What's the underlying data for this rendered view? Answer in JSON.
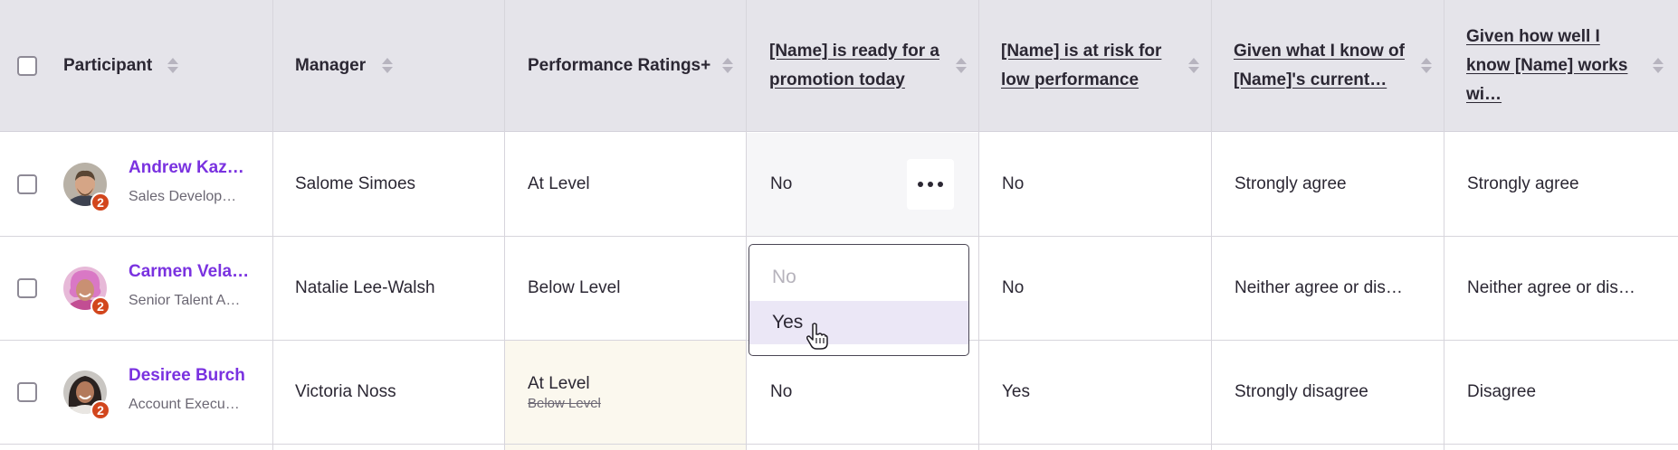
{
  "header": {
    "participant": "Participant",
    "manager": "Manager",
    "performance": "Performance Ratings+",
    "q1_line1": "[Name] is ready for a",
    "q1_line2": "promotion today",
    "q2_line1": "[Name] is at risk for",
    "q2_line2": "low performance",
    "q3_line1": "Given what I know of",
    "q3_line2": "[Name]'s current…",
    "q4_line1": "Given how well I",
    "q4_line2": "know [Name] works",
    "q4_line3": "wi…"
  },
  "rows": [
    {
      "name": "Andrew Kaz…",
      "title": "Sales Develop…",
      "badge": "2",
      "manager": "Salome Simoes",
      "rating": "At Level",
      "rating_previous": "",
      "q1": "No",
      "q2": "No",
      "q3": "Strongly agree",
      "q4": "Strongly agree"
    },
    {
      "name": "Carmen Vela…",
      "title": "Senior Talent A…",
      "badge": "2",
      "manager": "Natalie Lee-Walsh",
      "rating": "Below Level",
      "rating_previous": "",
      "q1": "",
      "q2": "No",
      "q3": "Neither agree or dis…",
      "q4": "Neither agree or dis…"
    },
    {
      "name": "Desiree Burch",
      "title": "Account Execu…",
      "badge": "2",
      "manager": "Victoria Noss",
      "rating": "At Level",
      "rating_previous": "Below Level",
      "q1": "No",
      "q2": "Yes",
      "q3": "Strongly disagree",
      "q4": "Disagree"
    }
  ],
  "dropdown": {
    "options": [
      "No",
      "Yes"
    ],
    "hovered": "Yes"
  },
  "colors": {
    "header_bg": "#e5e4ea",
    "name_link": "#7a32e0",
    "badge": "#d2461d",
    "edited_cell": "#fbf8ee",
    "active_cell": "#f6f6f8",
    "dropdown_hover": "#ebe7f6"
  }
}
